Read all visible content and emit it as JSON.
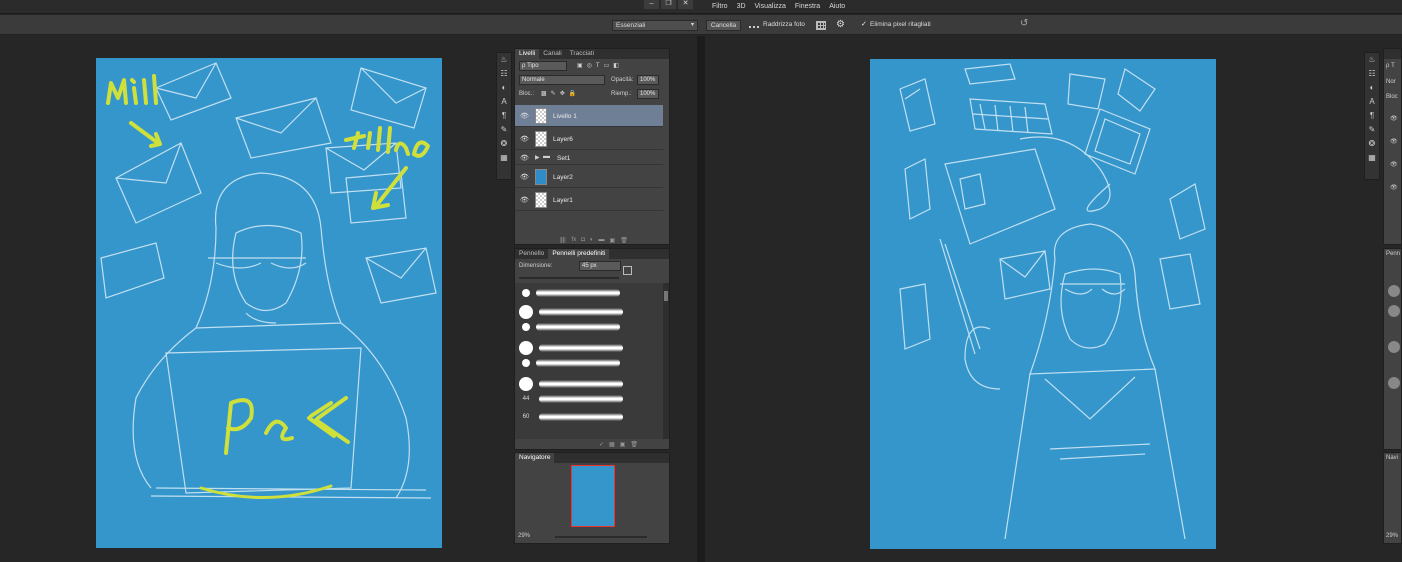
{
  "window": {
    "minimize_label": "‒",
    "restore_label": "❐",
    "close_label": "✕"
  },
  "menu": {
    "items": [
      "Filtro",
      "3D",
      "Visualizza",
      "Finestra",
      "Aiuto"
    ]
  },
  "options_bar": {
    "workspace_value": "Essenziali",
    "cancel_label": "Cancella",
    "straighten_label": "Raddrizza foto",
    "delete_pixels_label": "Elimina pixel ritagliati",
    "delete_pixels_checked": true
  },
  "layers_panel": {
    "tabs": [
      "Livelli",
      "Canali",
      "Tracciati"
    ],
    "filter_label": "ρ Tipo",
    "blend_mode": "Normale",
    "opacity_label": "Opacità:",
    "opacity_value": "100%",
    "lock_label": "Bloc.:",
    "fill_label": "Riemp.:",
    "fill_value": "100%",
    "layers": [
      {
        "name": "Livello 1",
        "selected": true,
        "thumb": "transparent"
      },
      {
        "name": "Layer6",
        "selected": false,
        "thumb": "transparent"
      },
      {
        "name": "Set1",
        "selected": false,
        "thumb": "folder"
      },
      {
        "name": "Layer2",
        "selected": false,
        "thumb": "blue"
      },
      {
        "name": "Layer1",
        "selected": false,
        "thumb": "transparent"
      }
    ]
  },
  "brush_panel": {
    "tabs": [
      "Pennello",
      "Pennelli predefiniti"
    ],
    "size_label": "Dimensione:",
    "size_value": "45 px",
    "preset_numbers": [
      "44",
      "60"
    ]
  },
  "navigator_panel": {
    "title": "Navigatore",
    "zoom": "29%"
  },
  "right_panels": {
    "filter_label": "ρ T",
    "blend_label": "Nor",
    "lock_label": "Bloc",
    "brush_label": "Penn",
    "navigator_label": "Navi",
    "zoom": "29%"
  },
  "canvas_left": {
    "annotations": [
      "mail",
      "tillage",
      "pec"
    ],
    "background_color": "#3596cc",
    "annotation_color": "#cfe03a"
  },
  "canvas_right": {
    "background_color": "#3596cc"
  }
}
